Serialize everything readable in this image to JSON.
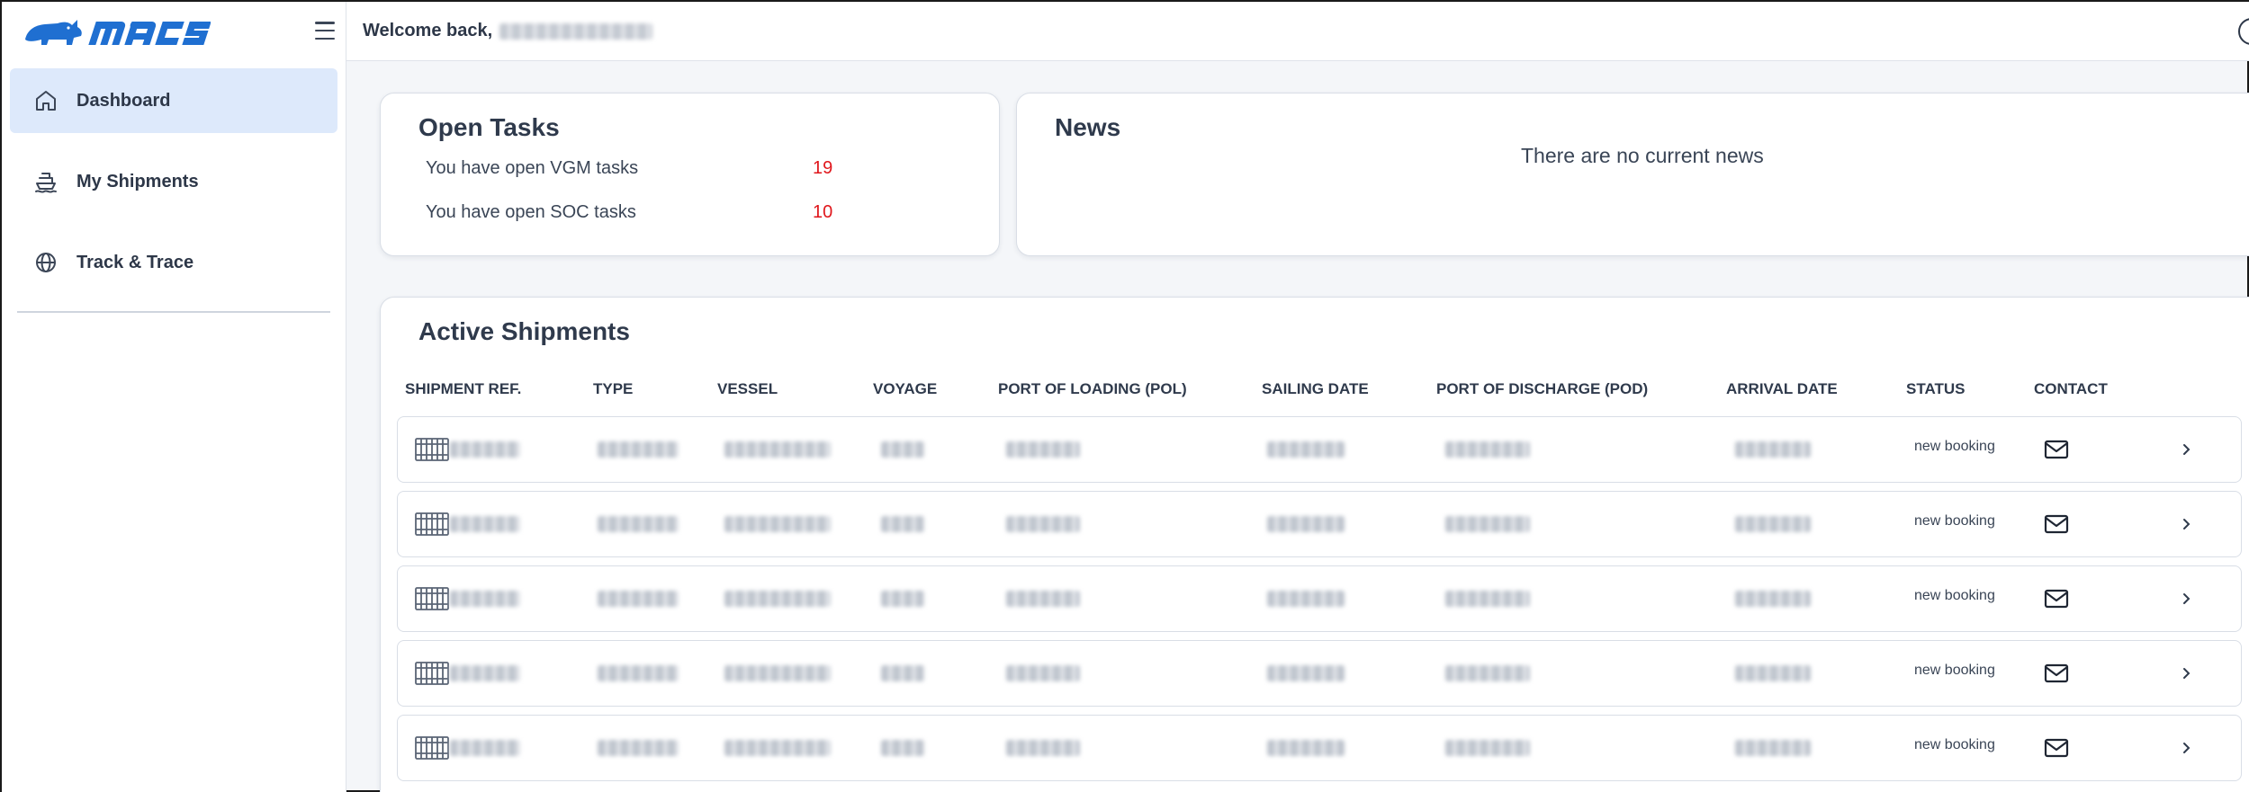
{
  "brand": {
    "name": "macs",
    "logo_color": "#1f6fd1"
  },
  "header": {
    "welcome": "Welcome back,",
    "user_name": "█████ ████ ██████"
  },
  "sidebar": {
    "items": [
      {
        "label": "Dashboard",
        "icon": "home-icon",
        "active": true
      },
      {
        "label": "My Shipments",
        "icon": "ship-icon",
        "active": false
      },
      {
        "label": "Track & Trace",
        "icon": "globe-icon",
        "active": false
      }
    ]
  },
  "open_tasks": {
    "title": "Open Tasks",
    "rows": [
      {
        "label": "You have open VGM tasks",
        "count": "19"
      },
      {
        "label": "You have open SOC tasks",
        "count": "10"
      }
    ]
  },
  "news": {
    "title": "News",
    "empty_text": "There are no current news"
  },
  "shipments": {
    "title": "Active Shipments",
    "columns": [
      "SHIPMENT REF.",
      "TYPE",
      "VESSEL",
      "VOYAGE",
      "PORT OF LOADING (POL)",
      "SAILING DATE",
      "PORT OF DISCHARGE (POD)",
      "ARRIVAL DATE",
      "STATUS",
      "CONTACT"
    ],
    "rows": [
      {
        "ref": "██████",
        "type": "██████",
        "vessel": "███████",
        "voyage": "███",
        "pol": "██████",
        "sailing": "██ ██ ████",
        "pod": "███████",
        "arrival": "██████",
        "status": "new booking"
      },
      {
        "ref": "██████",
        "type": "██████",
        "vessel": "████████",
        "voyage": "███",
        "pol": "██████",
        "sailing": "██ ██ ████",
        "pod": "███████",
        "arrival": "██████",
        "status": "new booking"
      },
      {
        "ref": "██████",
        "type": "██████",
        "vessel": "████████",
        "voyage": "███",
        "pol": "██████",
        "sailing": "██ ██ ████",
        "pod": "███████",
        "arrival": "██████",
        "status": "new booking"
      },
      {
        "ref": "██████",
        "type": "██████",
        "vessel": "████████",
        "voyage": "███",
        "pol": "██████",
        "sailing": "██ ██ ████",
        "pod": "███████",
        "arrival": "██████",
        "status": "new booking"
      },
      {
        "ref": "██████",
        "type": "██████",
        "vessel": "████████",
        "voyage": "███",
        "pol": "██████",
        "sailing": "██ ██ ████",
        "pod": "███████",
        "arrival": "██████",
        "status": "new booking"
      }
    ]
  },
  "colors": {
    "active_nav": "#dde9fb",
    "task_count": "#e0161b",
    "text": "#2f3a4c"
  }
}
